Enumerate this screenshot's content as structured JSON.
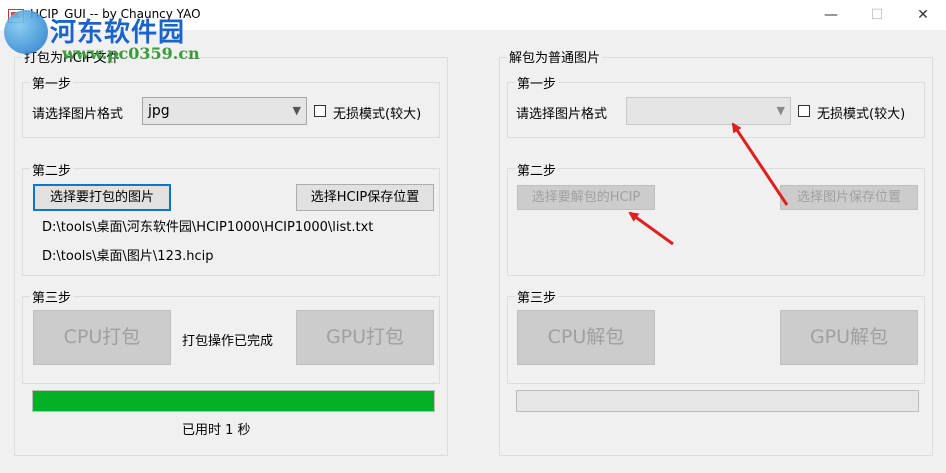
{
  "window": {
    "title": "HCIP_GUI -- by Chauncy YAO",
    "minimize_glyph": "—",
    "maximize_glyph": "☐",
    "close_glyph": "✕"
  },
  "watermark": {
    "title": "河东软件园",
    "url": "www.pc0359.cn"
  },
  "pack": {
    "title": "打包为HCIP文件",
    "step1": {
      "title": "第一步",
      "format_label": "请选择图片格式",
      "format_value": "jpg",
      "lossless_label": "无损模式(较大)",
      "lossless_checked": false
    },
    "step2": {
      "title": "第二步",
      "select_images_button": "选择要打包的图片",
      "select_save_button": "选择HCIP保存位置",
      "images_path": "D:\\tools\\桌面\\河东软件园\\HCIP1000\\HCIP1000\\list.txt",
      "save_path": "D:\\tools\\桌面\\图片\\123.hcip"
    },
    "step3": {
      "title": "第三步",
      "cpu_button": "CPU打包",
      "status": "打包操作已完成",
      "gpu_button": "GPU打包"
    },
    "progress": 1.0,
    "elapsed": "已用时 1 秒"
  },
  "unpack": {
    "title": "解包为普通图片",
    "step1": {
      "title": "第一步",
      "format_label": "请选择图片格式",
      "format_value": "",
      "lossless_label": "无损模式(较大)",
      "lossless_checked": false
    },
    "step2": {
      "title": "第二步",
      "select_hcip_button": "选择要解包的HCIP",
      "select_save_button": "选择图片保存位置"
    },
    "step3": {
      "title": "第三步",
      "cpu_button": "CPU解包",
      "gpu_button": "GPU解包"
    },
    "progress": 0
  },
  "colors": {
    "progress_fill": "#06b025",
    "annotation_arrow": "#e02020",
    "focus_border": "#0078d7"
  }
}
